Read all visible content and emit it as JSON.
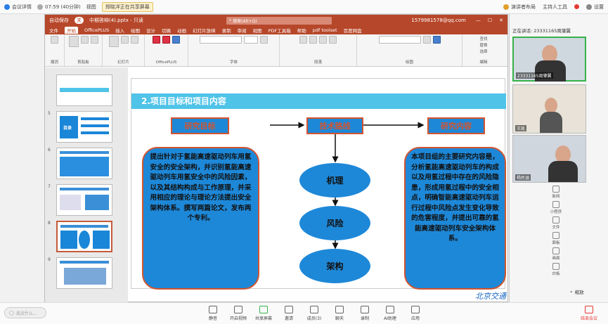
{
  "meeting_top": {
    "meeting_details": "会议详情",
    "time": "07:59 (40分钟)",
    "view": "视图",
    "sharing_notice": "郑晓洋正在共享屏幕",
    "speaker": "演讲者布局",
    "host": "主持人工具",
    "settings": "设置"
  },
  "ppt": {
    "autosave": "自动保存",
    "autosave_state": "关",
    "filename": "中期答辩(4).pptx - 只读",
    "search_placeholder": "搜索(Alt+Q)",
    "account": "1579981578@qq.com",
    "tabs": [
      "文件",
      "开始",
      "OfficePLUS",
      "插入",
      "绘图",
      "设计",
      "切换",
      "动画",
      "幻灯片放映",
      "录制",
      "审阅",
      "视图",
      "PDF工具箱",
      "帮助",
      "pdf toolset",
      "百度网盘"
    ],
    "active_tab": "开始",
    "ribbon_groups": [
      "撤消",
      "剪贴板",
      "幻灯片",
      "OfficePLUS",
      "字体",
      "段落",
      "绘图",
      "编辑"
    ],
    "ribbon_labels": {
      "paste": "粘贴",
      "new_slide": "新建幻灯片",
      "reuse": "重用幻灯片",
      "template": "模板",
      "chart": "图表",
      "find": "查找",
      "replace": "替换",
      "select": "选择"
    },
    "thumb_numbers": [
      "5",
      "6",
      "7",
      "8",
      "9"
    ],
    "thumb_catalog": "目录"
  },
  "slide": {
    "title": "2.项目目标和项目内容",
    "research_goal": "研究目标",
    "tech_route": "技术路线",
    "research_content": "研究内容",
    "left_text": "提出针对于氢能高速驱动列车用氢安全的安全架构，并识别氢能高速驱动列车用氢安全中的风险因素，以及其结构构成与工作原理，并采用相应的理论与理论方法提出安全架构体系。撰写两篇论文，发布两个专利。",
    "right_text": "本项目组的主要研究内容是，分析氢能高速驱动列车的构成以及用氢过程中存在的风险隐患，形成用氢过程中的安全相点，明确智能高速驱动列车运行过程中风险点发生变化导致的危害程度，并提出可靠的氢能高速驱动列车安全架构体系。",
    "mechanism": "机理",
    "risk": "风险",
    "structure": "架构",
    "logo": "北京交通大学"
  },
  "right_panel": {
    "speaking": "正在讲话: 23331165周肇翼",
    "participants": [
      "23331165周肇翼",
      "王凯",
      "杨民涵"
    ],
    "tools": [
      "新网",
      "小程序",
      "文件",
      "面板",
      "画面",
      "白板"
    ],
    "zoom_label": "缩放"
  },
  "bottom": {
    "comment_placeholder": "说点什么...",
    "items": [
      "静音",
      "开启视频",
      "共享屏幕",
      "邀请",
      "成员(3)",
      "聊天",
      "录制",
      "AI助理",
      "应用"
    ],
    "leave": "结束会议"
  }
}
